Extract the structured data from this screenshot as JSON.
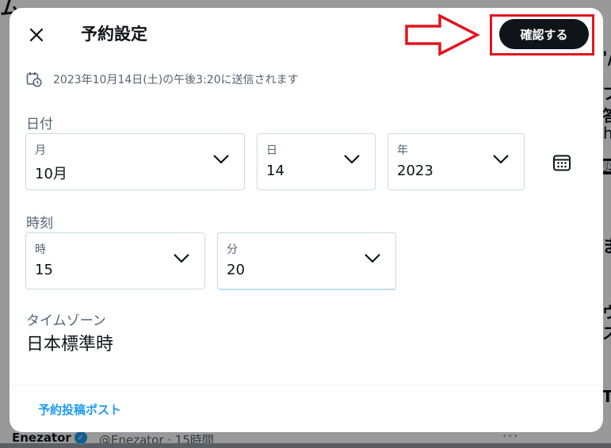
{
  "background": {
    "header_fragment": "ム",
    "right_fragments": [
      "'/",
      "フ",
      "答",
      "h",
      "題",
      "ま",
      "ウ",
      "ス",
      "T"
    ],
    "author_name": "Enezator",
    "author_handle": "@Enezator · 15時間",
    "more": "···"
  },
  "modal": {
    "title": "予約設定",
    "confirm_label": "確認する",
    "scheduled_text": "2023年10月14日(土)の午後3:20に送信されます",
    "date_section_label": "日付",
    "month": {
      "label": "月",
      "value": "10月"
    },
    "day": {
      "label": "日",
      "value": "14"
    },
    "year": {
      "label": "年",
      "value": "2023"
    },
    "time_section_label": "時刻",
    "hour": {
      "label": "時",
      "value": "15"
    },
    "minute": {
      "label": "分",
      "value": "20"
    },
    "timezone_label": "タイムゾーン",
    "timezone_value": "日本標準時",
    "scheduled_posts_link": "予約投稿ポスト"
  },
  "colors": {
    "accent": "#1d9bf0",
    "annotation": "#e3141d",
    "button_bg": "#0f1419"
  },
  "icons": [
    "close-icon",
    "calendar-clock-icon",
    "chevron-down-icon",
    "calendar-icon",
    "verified-badge-icon",
    "arrow-annotation"
  ]
}
